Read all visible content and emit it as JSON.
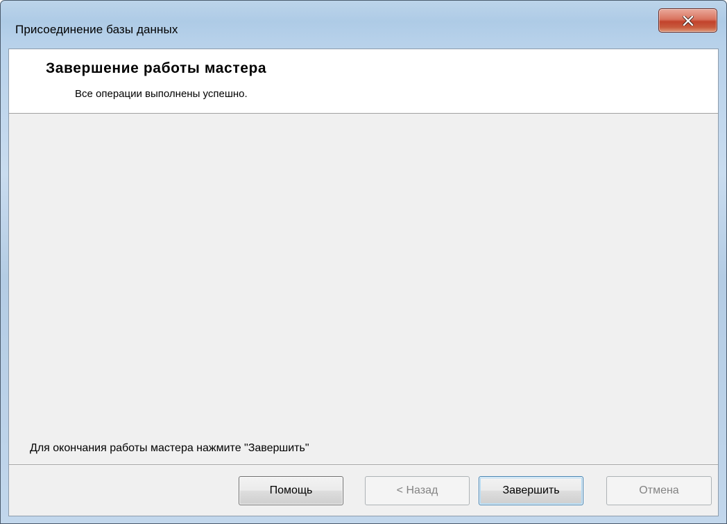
{
  "window": {
    "title": "Присоединение базы данных",
    "close_icon": "close-icon"
  },
  "header": {
    "title": "Завершение работы мастера",
    "subtitle": "Все операции выполнены успешно."
  },
  "body": {
    "hint": "Для окончания работы мастера нажмите \"Завершить\""
  },
  "buttons": {
    "help": "Помощь",
    "back": "< Назад",
    "finish": "Завершить",
    "cancel": "Отмена",
    "back_enabled": false,
    "cancel_enabled": false,
    "finish_default": true
  },
  "colors": {
    "close_button": "#c2432c",
    "default_button_border": "#3c7fb1",
    "disabled_text": "#838383"
  }
}
